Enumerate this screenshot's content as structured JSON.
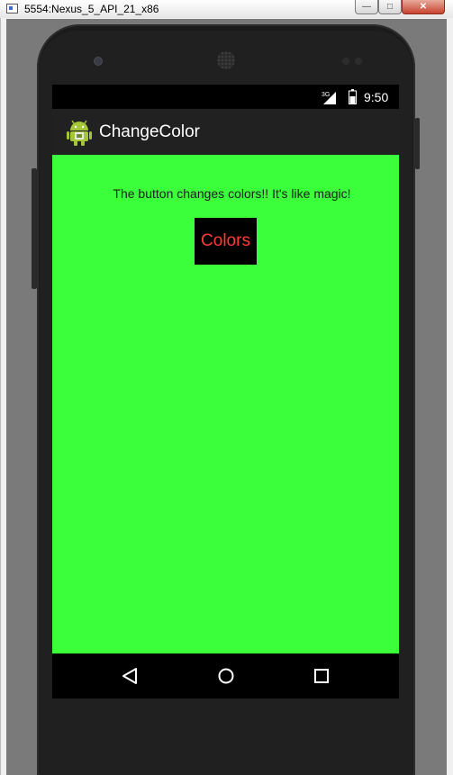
{
  "window": {
    "title": "5554:Nexus_5_API_21_x86",
    "controls": [
      "minimize-icon",
      "maximize-icon",
      "close-icon"
    ]
  },
  "status_bar": {
    "network": "3G",
    "time": "9:50",
    "icons": [
      "signal-icon",
      "battery-icon"
    ]
  },
  "action_bar": {
    "icon": "android-icon",
    "title": "ChangeColor"
  },
  "content": {
    "background_color": "#3aff3a",
    "message": "The button changes colors!! It's like magic!",
    "button": {
      "label": "Colors",
      "background_color": "#000000",
      "text_color": "#ff3b3b"
    }
  },
  "nav_bar": {
    "icons": [
      "back-icon",
      "home-icon",
      "recent-apps-icon"
    ]
  }
}
